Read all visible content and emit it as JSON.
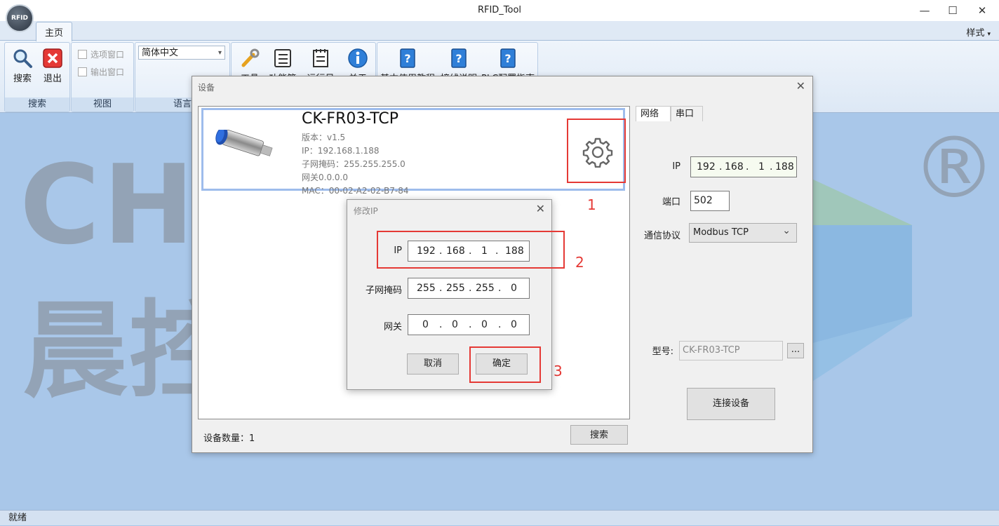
{
  "window": {
    "title": "RFID_Tool",
    "logo_text": "RFID",
    "minimize_icon": "minimize-icon",
    "maximize_icon": "maximize-icon",
    "close_icon": "close-icon"
  },
  "ribbon": {
    "tabs": [
      {
        "label": "主页",
        "active": true
      }
    ],
    "style_menu": "样式",
    "groups": {
      "search": {
        "label": "搜索",
        "buttons": [
          {
            "label": "搜索",
            "icon": "magnifier-icon"
          },
          {
            "label": "退出",
            "icon": "exit-icon"
          }
        ]
      },
      "view": {
        "label": "视图",
        "checkboxes": [
          {
            "label": "选项窗口",
            "checked": false
          },
          {
            "label": "输出窗口",
            "checked": false
          }
        ]
      },
      "language": {
        "label": "语言",
        "selected": "简体中文"
      },
      "tools": {
        "buttons": [
          {
            "label": "工具",
            "icon": "wrench-icon"
          },
          {
            "label": "功能管理",
            "icon": "checklist-icon"
          },
          {
            "label": "运行日志",
            "icon": "log-icon"
          },
          {
            "label": "关于",
            "icon": "info-icon"
          }
        ]
      },
      "help": {
        "buttons": [
          {
            "label": "基本使用教程",
            "icon": "help-book-icon"
          },
          {
            "label": "接线说明",
            "icon": "help-book-icon"
          },
          {
            "label": "PLC配置指南",
            "icon": "help-book-icon"
          }
        ]
      }
    }
  },
  "watermark": {
    "brand": "CHENKONG",
    "cn": "晨控智能",
    "registered": "®"
  },
  "device_dialog": {
    "title": "设备",
    "device": {
      "name": "CK-FR03-TCP",
      "version": "版本：v1.5",
      "ip": "IP：192.168.1.188",
      "subnet": "子网掩码：255.255.255.0",
      "gateway": "网关0.0.0.0",
      "mac": "MAC：00-02-A2-02-B7-84"
    },
    "count_label": "设备数量：1",
    "search_button": "搜索",
    "tabs": [
      "网络",
      "串口"
    ],
    "ip_label": "IP",
    "ip_octets": [
      "192",
      "168",
      "1",
      "188"
    ],
    "port_label": "端口",
    "port_value": "502",
    "protocol_label": "通信协议",
    "protocol_value": "Modbus TCP",
    "model_label": "型号:",
    "model_value": "CK-FR03-TCP",
    "browse_button": "...",
    "connect_button": "连接设备"
  },
  "modify_ip_dialog": {
    "title": "修改IP",
    "ip_label": "IP",
    "ip_octets": [
      "192",
      "168",
      "1",
      "188"
    ],
    "subnet_label": "子网掩码",
    "subnet_octets": [
      "255",
      "255",
      "255",
      "0"
    ],
    "gateway_label": "网关",
    "gateway_octets": [
      "0",
      "0",
      "0",
      "0"
    ],
    "cancel_button": "取消",
    "ok_button": "确定"
  },
  "annotations": {
    "step1": "1",
    "step2": "2",
    "step3": "3",
    "highlight_color": "#e53935"
  },
  "status": {
    "text": "就绪"
  }
}
